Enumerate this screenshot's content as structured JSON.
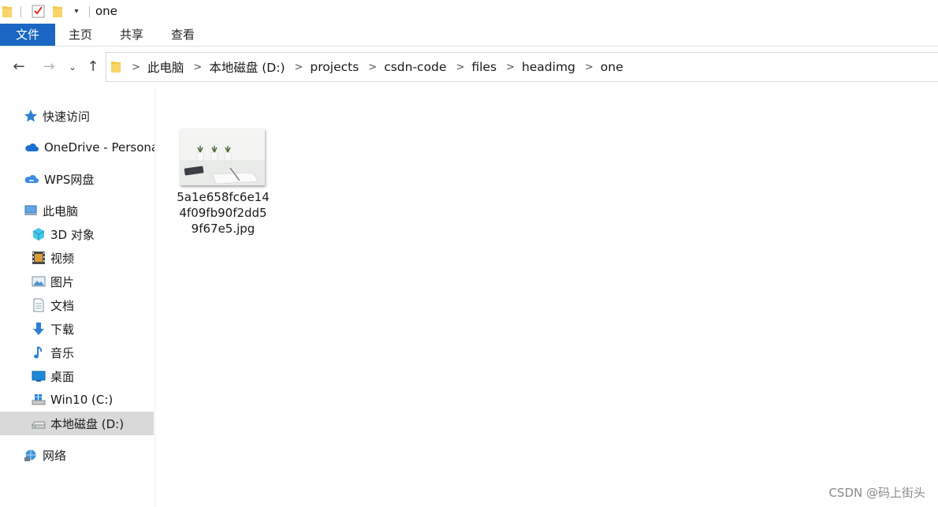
{
  "window": {
    "title": "one"
  },
  "ribbon": {
    "tabs": [
      {
        "label": "文件",
        "active": true
      },
      {
        "label": "主页"
      },
      {
        "label": "共享"
      },
      {
        "label": "查看"
      }
    ]
  },
  "address": {
    "breadcrumbs": [
      "此电脑",
      "本地磁盘 (D:)",
      "projects",
      "csdn-code",
      "files",
      "headimg",
      "one"
    ]
  },
  "sidebar": {
    "items": [
      {
        "label": "快速访问",
        "icon": "star-icon"
      },
      {
        "label": "OneDrive - Personal",
        "icon": "onedrive-cloud-icon"
      },
      {
        "label": "WPS网盘",
        "icon": "wps-cloud-icon"
      },
      {
        "label": "此电脑",
        "icon": "computer-icon"
      },
      {
        "label": "3D 对象",
        "icon": "3d-objects-icon"
      },
      {
        "label": "视频",
        "icon": "video-icon"
      },
      {
        "label": "图片",
        "icon": "pictures-icon"
      },
      {
        "label": "文档",
        "icon": "documents-icon"
      },
      {
        "label": "下载",
        "icon": "download-icon"
      },
      {
        "label": "音乐",
        "icon": "music-icon"
      },
      {
        "label": "桌面",
        "icon": "desktop-icon"
      },
      {
        "label": "Win10 (C:)",
        "icon": "windows-drive-icon"
      },
      {
        "label": "本地磁盘 (D:)",
        "icon": "drive-icon",
        "selected": true
      },
      {
        "label": "网络",
        "icon": "network-icon"
      }
    ]
  },
  "files": [
    {
      "name": "5a1e658fc6e144f09fb90f2dd59f67e5.jpg",
      "icon": "image-thumbnail"
    }
  ],
  "watermark": "CSDN @码上街头",
  "colors": {
    "accent": "#1a66c2",
    "selected_bg": "#d9d9d9",
    "folder": "#f4c84a"
  }
}
